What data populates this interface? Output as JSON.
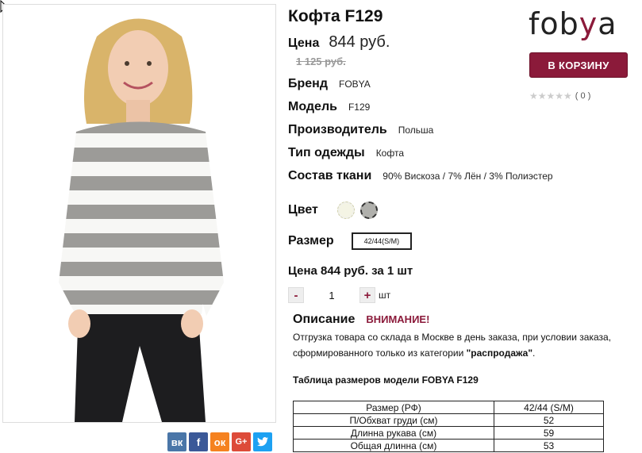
{
  "product": {
    "title": "Кофта F129",
    "price_label": "Цена",
    "price": "844 руб.",
    "old_price": "1 125 руб.",
    "brand_label": "Бренд",
    "brand": "FOBYA",
    "model_label": "Модель",
    "model": "F129",
    "maker_label": "Производитель",
    "maker": "Польша",
    "type_label": "Тип одежды",
    "type": "Кофта",
    "fabric_label": "Состав ткани",
    "fabric": "90% Вискоза / 7% Лён / 3% Полиэстер",
    "color_label": "Цвет",
    "size_label": "Размер",
    "size_option": "42/44(S/M)",
    "unit_price_text": "Цена 844 руб. за 1 шт",
    "quantity": "1",
    "minus": "-",
    "plus": "+",
    "unit": "шт"
  },
  "description": {
    "label": "Описание",
    "warning": "ВНИМАНИЕ!",
    "text_1": "Отгрузка товара со склада в Москве в день заказа, при условии заказа,",
    "text_2": "сформированного только из категории ",
    "category": "\"распродажа\"",
    "text_end": "."
  },
  "size_table": {
    "title": "Таблица размеров модели FOBYA F129",
    "rows": [
      [
        "Размер (РФ)",
        "42/44 (S/M)"
      ],
      [
        "П/Обхват груди (см)",
        "52"
      ],
      [
        "Длинна рукава (см)",
        "59"
      ],
      [
        "Общая длинна (см)",
        "53"
      ]
    ]
  },
  "brand_logo": {
    "pre": "fob",
    "y": "y",
    "post": "a"
  },
  "cart_button": "В КОРЗИНУ",
  "rating": {
    "stars": "★★★★★",
    "count": "( 0 )"
  },
  "social": [
    "vk-icon",
    "facebook-icon",
    "odnoklassniki-icon",
    "google-plus-icon",
    "twitter-icon"
  ],
  "colors": {
    "accent": "#8b1a3a",
    "swatch_1": "#f4f4e4",
    "swatch_2": "#b0b0ac"
  }
}
